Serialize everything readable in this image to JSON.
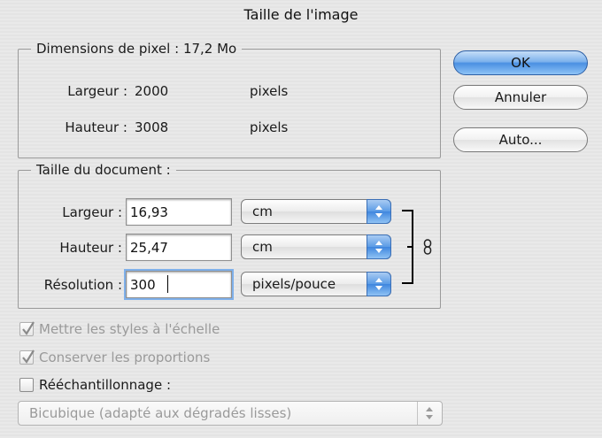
{
  "dialog": {
    "title": "Taille de l'image"
  },
  "pixel_dimensions": {
    "legend": "Dimensions de pixel :",
    "size": "17,2 Mo",
    "width_label": "Largeur :",
    "width_value": "2000",
    "width_unit": "pixels",
    "height_label": "Hauteur :",
    "height_value": "3008",
    "height_unit": "pixels"
  },
  "document_size": {
    "legend": "Taille du document :",
    "width_label": "Largeur :",
    "width_value": "16,93",
    "width_unit": "cm",
    "height_label": "Hauteur :",
    "height_value": "25,47",
    "height_unit": "cm",
    "resolution_label": "Résolution :",
    "resolution_value": "300",
    "resolution_unit": "pixels/pouce"
  },
  "buttons": {
    "ok": "OK",
    "cancel": "Annuler",
    "auto": "Auto..."
  },
  "options": {
    "scale_styles": {
      "label": "Mettre les styles à l'échelle",
      "checked": true,
      "enabled": false
    },
    "constrain": {
      "label": "Conserver les proportions",
      "checked": true,
      "enabled": false
    },
    "resample": {
      "label": "Rééchantillonnage :",
      "checked": false,
      "enabled": true
    },
    "resample_method": "Bicubique (adapté aux dégradés lisses)"
  },
  "colors": {
    "accent": "#4a90e2",
    "link_bracket": "#000000"
  },
  "icons": {
    "link": "chain-link-icon",
    "popup": "up-down-arrows-icon",
    "check": "checkmark-icon"
  }
}
